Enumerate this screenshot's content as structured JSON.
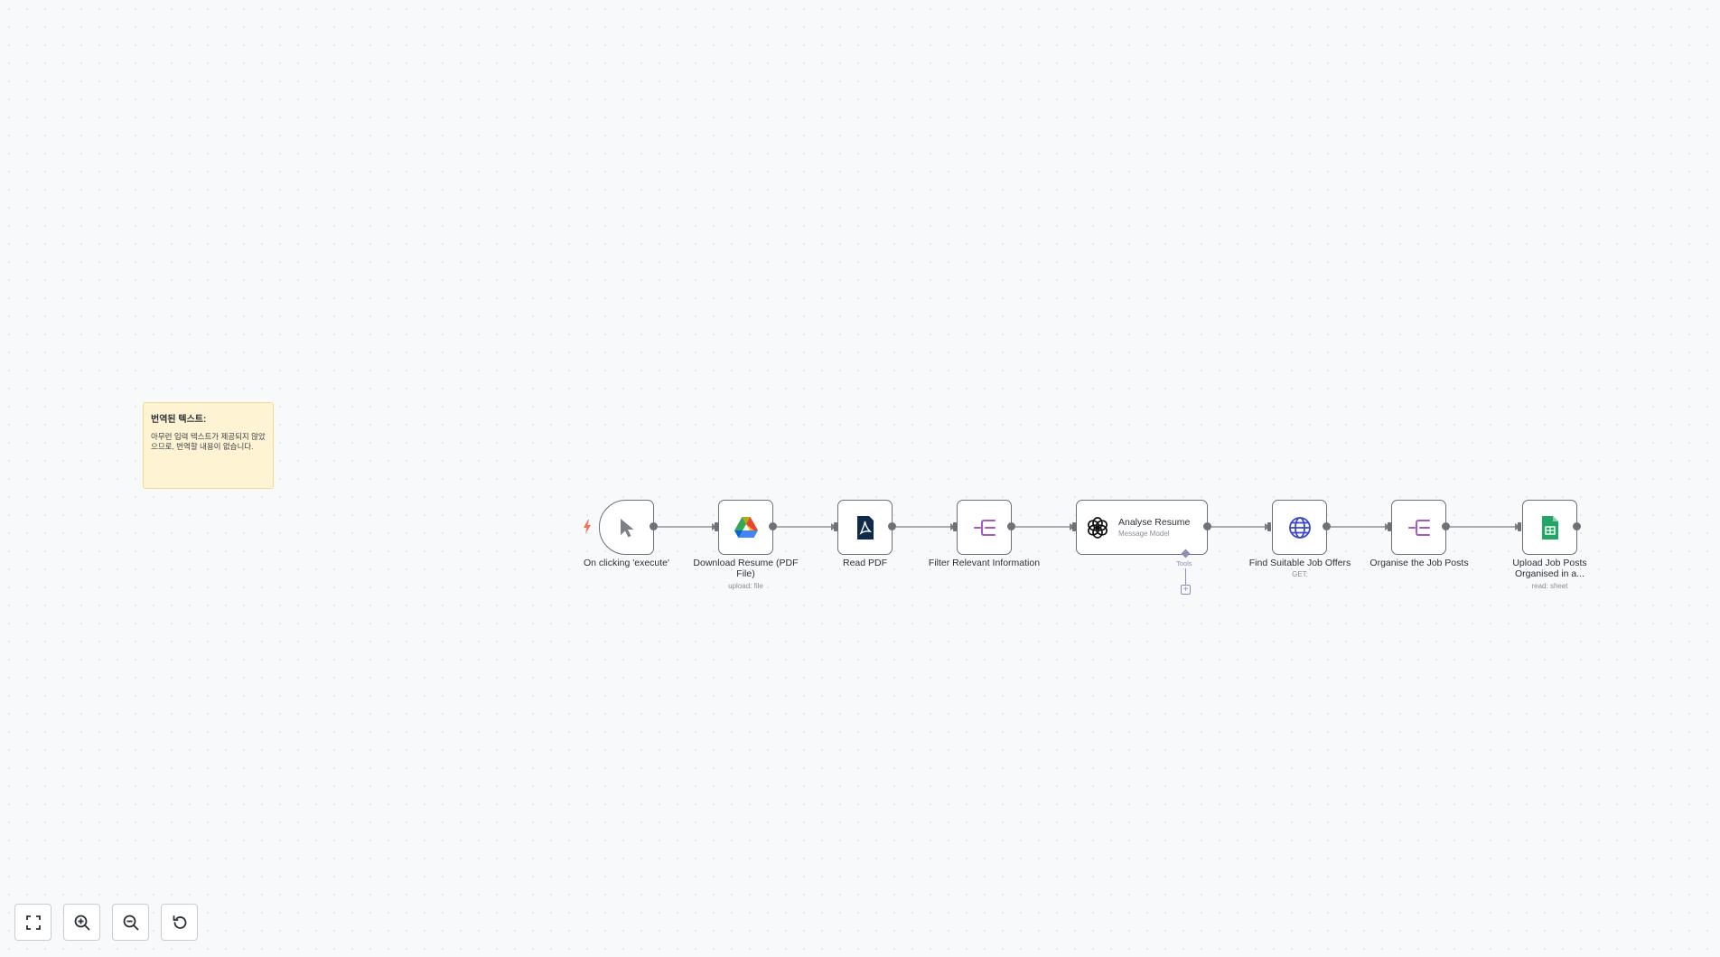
{
  "sticky_note": {
    "title": "번역된 텍스트:",
    "body": "아무런 입력 텍스트가 제공되지 않았으므로, 번역할 내용이 없습니다."
  },
  "nodes": [
    {
      "id": "trigger",
      "label": "On clicking 'execute'",
      "subtitle": "",
      "icon": "cursor-pointer-icon"
    },
    {
      "id": "gdrive",
      "label": "Download Resume (PDF File)",
      "subtitle": "upload: file",
      "icon": "google-drive-icon"
    },
    {
      "id": "readpdf",
      "label": "Read PDF",
      "subtitle": "",
      "icon": "pdf-icon"
    },
    {
      "id": "filter",
      "label": "Filter Relevant Information",
      "subtitle": "",
      "icon": "set-fields-icon"
    },
    {
      "id": "openai",
      "label": "Analyse Resume",
      "subtitle": "Message Model",
      "icon": "openai-icon",
      "tools_label": "Tools"
    },
    {
      "id": "http",
      "label": "Find Suitable Job Offers",
      "subtitle": "GET:",
      "icon": "globe-icon"
    },
    {
      "id": "organise",
      "label": "Organise the Job Posts",
      "subtitle": "",
      "icon": "set-fields-icon"
    },
    {
      "id": "sheets",
      "label": "Upload Job Posts Organised in a...",
      "subtitle": "read: sheet",
      "icon": "google-sheets-icon"
    }
  ],
  "controls": {
    "fit_view": "fit-view-icon",
    "zoom_in": "zoom-in-icon",
    "zoom_out": "zoom-out-icon",
    "reset": "reset-zoom-icon"
  },
  "colors": {
    "canvas_bg": "#f7f9fb",
    "node_border": "#6b6f76",
    "sticky_bg": "#fef3d3",
    "trigger_bolt": "#ff6d5a",
    "set_node_purple": "#a259c9",
    "pdf_navy": "#0f2a4a",
    "sheets_green": "#23a566",
    "globe_blue": "#3a46c9"
  }
}
